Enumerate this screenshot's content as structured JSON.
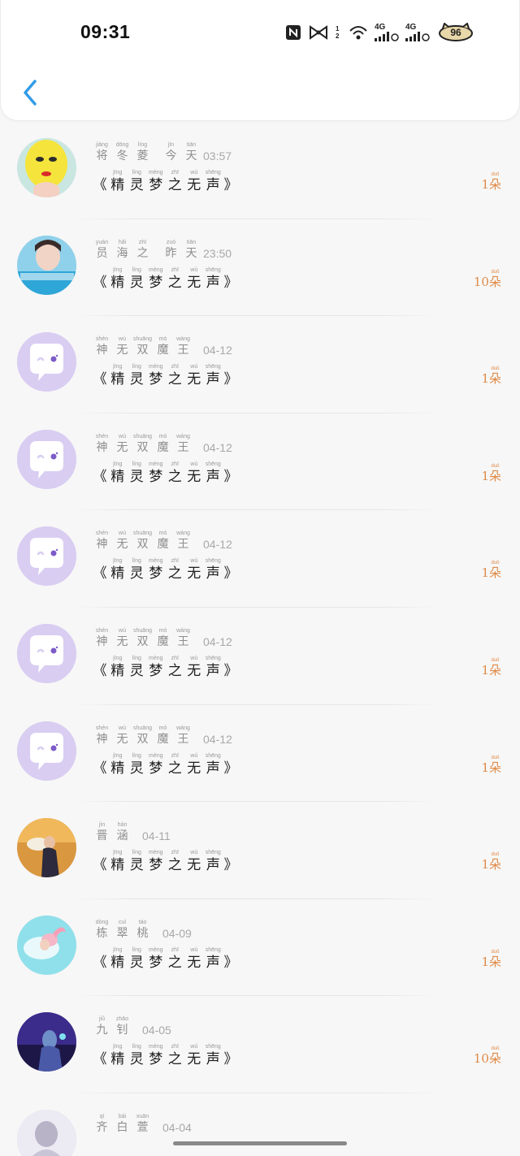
{
  "status_bar": {
    "time": "09:31",
    "icons": [
      "nfc-icon",
      "bow-icon",
      "sim-indicator-icon",
      "wifi-icon",
      "signal-4g-icon",
      "signal-4g-icon",
      "cat-battery-icon"
    ],
    "sim_label": "1 2",
    "network_1": "4G",
    "network_2": "4G",
    "battery_level": "96"
  },
  "header": {
    "back_icon": "chevron-left-icon",
    "accent_color": "#2f9be8"
  },
  "colors": {
    "count_color": "#e08a46",
    "avatar_default_bg": "#d9cdf2"
  },
  "title_book": {
    "open": "《",
    "close": "》",
    "chars": [
      {
        "hz": "精",
        "py": "jīng"
      },
      {
        "hz": "灵",
        "py": "líng"
      },
      {
        "hz": "梦",
        "py": "mèng"
      },
      {
        "hz": "之",
        "py": "zhī"
      },
      {
        "hz": "无",
        "py": "wú"
      },
      {
        "hz": "声",
        "py": "shēng"
      }
    ]
  },
  "count_unit": {
    "hz": "朵",
    "py": "duǒ"
  },
  "records": [
    {
      "avatar": "photo-avatar-yellow",
      "name": [
        {
          "hz": "将",
          "py": "jiāng"
        },
        {
          "hz": "冬",
          "py": "dōng"
        },
        {
          "hz": "菱",
          "py": "líng"
        }
      ],
      "day": [
        {
          "hz": "今",
          "py": "jīn"
        },
        {
          "hz": "天",
          "py": "tiān"
        }
      ],
      "time": "03:57",
      "count": "1"
    },
    {
      "avatar": "photo-avatar-blue",
      "name": [
        {
          "hz": "员",
          "py": "yuán"
        },
        {
          "hz": "海",
          "py": "hǎi"
        },
        {
          "hz": "之",
          "py": "zhī"
        }
      ],
      "day": [
        {
          "hz": "昨",
          "py": "zuó"
        },
        {
          "hz": "天",
          "py": "tiān"
        }
      ],
      "time": "23:50",
      "count": "10"
    },
    {
      "avatar": "default-avatar",
      "name": [
        {
          "hz": "神",
          "py": "shén"
        },
        {
          "hz": "无",
          "py": "wú"
        },
        {
          "hz": "双",
          "py": "shuāng"
        },
        {
          "hz": "魔",
          "py": "mó"
        },
        {
          "hz": "王",
          "py": "wáng"
        }
      ],
      "day": [],
      "time": "04-12",
      "count": "1"
    },
    {
      "avatar": "default-avatar",
      "name": [
        {
          "hz": "神",
          "py": "shén"
        },
        {
          "hz": "无",
          "py": "wú"
        },
        {
          "hz": "双",
          "py": "shuāng"
        },
        {
          "hz": "魔",
          "py": "mó"
        },
        {
          "hz": "王",
          "py": "wáng"
        }
      ],
      "day": [],
      "time": "04-12",
      "count": "1"
    },
    {
      "avatar": "default-avatar",
      "name": [
        {
          "hz": "神",
          "py": "shén"
        },
        {
          "hz": "无",
          "py": "wú"
        },
        {
          "hz": "双",
          "py": "shuāng"
        },
        {
          "hz": "魔",
          "py": "mó"
        },
        {
          "hz": "王",
          "py": "wáng"
        }
      ],
      "day": [],
      "time": "04-12",
      "count": "1"
    },
    {
      "avatar": "default-avatar",
      "name": [
        {
          "hz": "神",
          "py": "shén"
        },
        {
          "hz": "无",
          "py": "wú"
        },
        {
          "hz": "双",
          "py": "shuāng"
        },
        {
          "hz": "魔",
          "py": "mó"
        },
        {
          "hz": "王",
          "py": "wáng"
        }
      ],
      "day": [],
      "time": "04-12",
      "count": "1"
    },
    {
      "avatar": "default-avatar",
      "name": [
        {
          "hz": "神",
          "py": "shén"
        },
        {
          "hz": "无",
          "py": "wú"
        },
        {
          "hz": "双",
          "py": "shuāng"
        },
        {
          "hz": "魔",
          "py": "mó"
        },
        {
          "hz": "王",
          "py": "wáng"
        }
      ],
      "day": [],
      "time": "04-12",
      "count": "1"
    },
    {
      "avatar": "photo-avatar-sunset",
      "name": [
        {
          "hz": "晋",
          "py": "jìn"
        },
        {
          "hz": "涵",
          "py": "hán"
        }
      ],
      "day": [],
      "time": "04-11",
      "count": "1"
    },
    {
      "avatar": "photo-avatar-pool",
      "name": [
        {
          "hz": "栋",
          "py": "dòng"
        },
        {
          "hz": "翠",
          "py": "cuì"
        },
        {
          "hz": "桃",
          "py": "táo"
        }
      ],
      "day": [],
      "time": "04-09",
      "count": "1"
    },
    {
      "avatar": "photo-avatar-dark",
      "name": [
        {
          "hz": "九",
          "py": "jiǔ"
        },
        {
          "hz": "钊",
          "py": "zhāo"
        }
      ],
      "day": [],
      "time": "04-05",
      "count": "10"
    },
    {
      "avatar": "photo-avatar-light",
      "name": [
        {
          "hz": "齐",
          "py": "qí"
        },
        {
          "hz": "白",
          "py": "bái"
        },
        {
          "hz": "萱",
          "py": "xuān"
        }
      ],
      "day": [],
      "time": "04-04",
      "count": ""
    }
  ]
}
